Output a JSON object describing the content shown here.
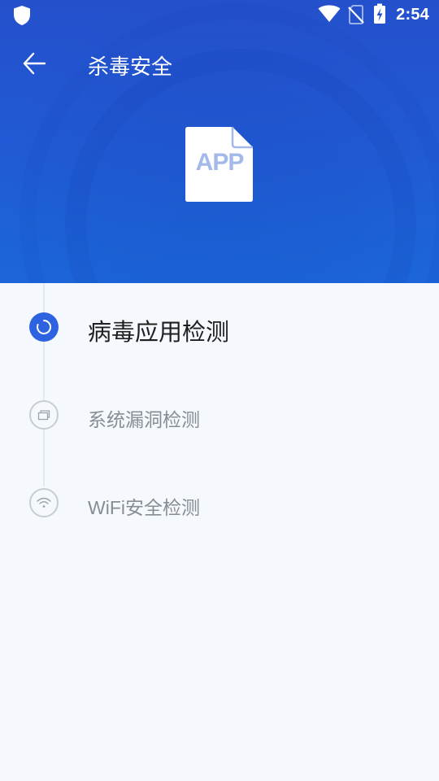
{
  "status_bar": {
    "time": "2:54",
    "icons": [
      "shield-icon",
      "wifi-icon",
      "no-sim-icon",
      "battery-charging-icon"
    ]
  },
  "app_bar": {
    "title": "杀毒安全",
    "back_icon": "arrow-left-icon"
  },
  "hero": {
    "file_label": "APP"
  },
  "steps": [
    {
      "label": "病毒应用检测",
      "state": "active",
      "icon": "loading-spinner-icon"
    },
    {
      "label": "系统漏洞检测",
      "state": "pending",
      "icon": "windows-stack-icon"
    },
    {
      "label": "WiFi安全检测",
      "state": "pending",
      "icon": "wifi-icon"
    }
  ],
  "colors": {
    "header_top": "#2550cc",
    "header_bottom": "#1c66da",
    "accent": "#2d63e0",
    "background": "#f5f8fd"
  }
}
